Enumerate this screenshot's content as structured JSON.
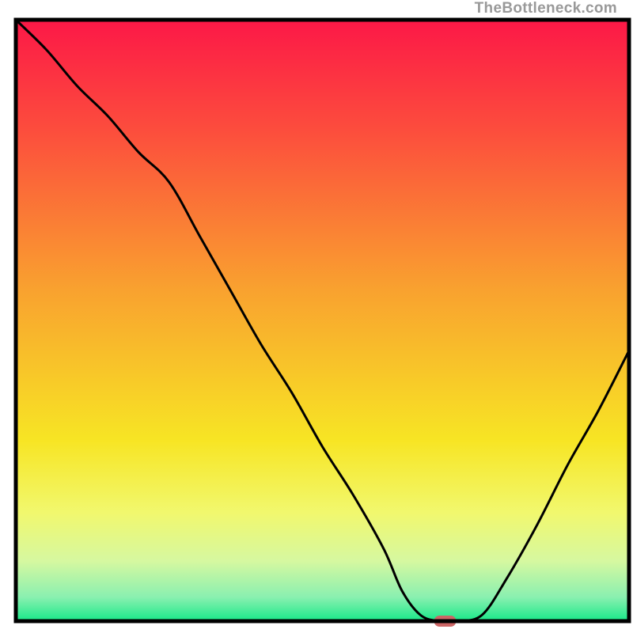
{
  "watermark": "TheBottleneck.com",
  "chart_data": {
    "type": "line",
    "title": "",
    "xlabel": "",
    "ylabel": "",
    "xlim": [
      0,
      100
    ],
    "ylim": [
      0,
      100
    ],
    "x": [
      0,
      5,
      10,
      15,
      20,
      25,
      30,
      35,
      40,
      45,
      50,
      55,
      60,
      63,
      66,
      69,
      72,
      76,
      80,
      85,
      90,
      95,
      100
    ],
    "values": [
      100,
      95,
      89,
      84,
      78,
      73,
      64,
      55,
      46,
      38,
      29,
      21,
      12,
      5,
      1,
      0,
      0,
      1,
      7,
      16,
      26,
      35,
      45
    ],
    "marker": {
      "x": 70,
      "y": 0,
      "color": "#cc6666"
    },
    "background": "vertical-gradient",
    "gradient_stops": [
      {
        "pos": 0.0,
        "color": "#fc1847"
      },
      {
        "pos": 0.18,
        "color": "#fc4c3d"
      },
      {
        "pos": 0.45,
        "color": "#f9a22f"
      },
      {
        "pos": 0.7,
        "color": "#f7e524"
      },
      {
        "pos": 0.82,
        "color": "#f1f86e"
      },
      {
        "pos": 0.9,
        "color": "#d6f8a0"
      },
      {
        "pos": 0.96,
        "color": "#8af0b0"
      },
      {
        "pos": 1.0,
        "color": "#18e989"
      }
    ]
  }
}
